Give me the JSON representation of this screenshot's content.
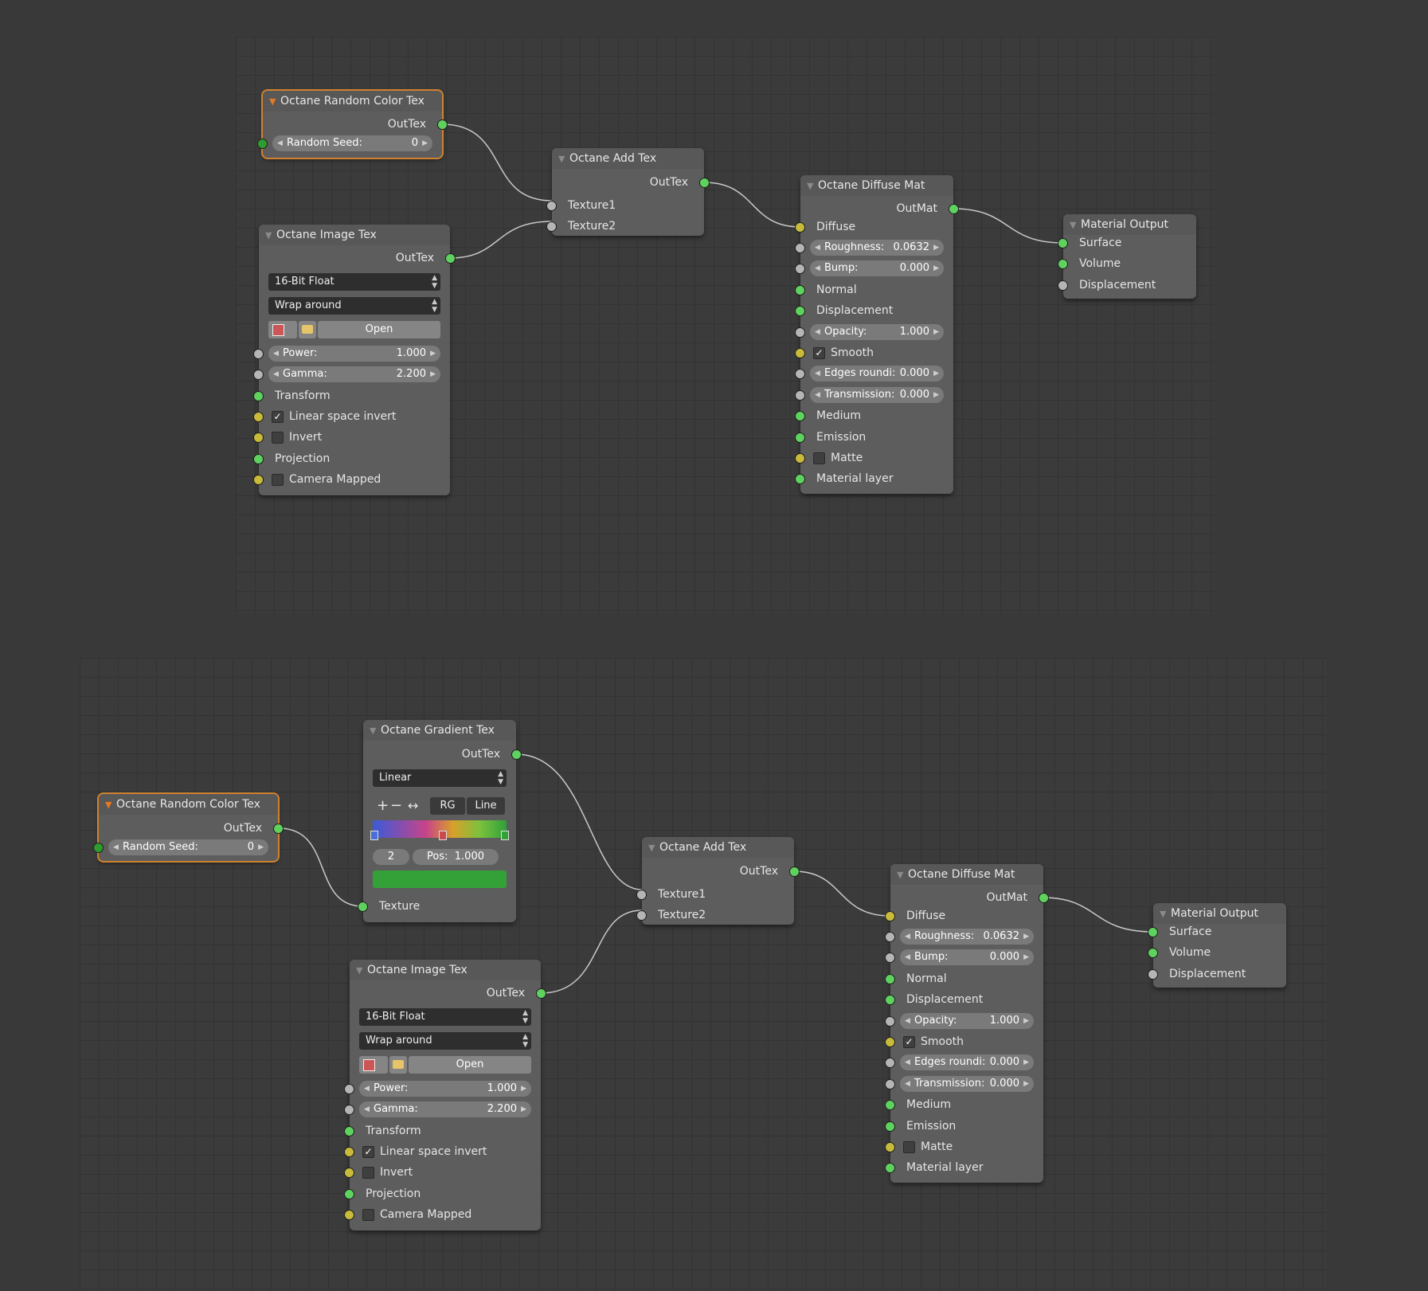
{
  "colors": {
    "accent_select": "#d0822e",
    "socket_green": "#5fd15f",
    "socket_yellow": "#c8bb3c",
    "socket_grey": "#b5b5b5",
    "ramp_stop": "#33a038"
  },
  "top": {
    "random": {
      "title": "Octane Random Color Tex",
      "out": "OutTex",
      "seed_label": "Random Seed:",
      "seed_value": "0"
    },
    "image": {
      "title": "Octane Image Tex",
      "out": "OutTex",
      "depth": "16-Bit Float",
      "wrap": "Wrap around",
      "open": "Open",
      "power_label": "Power:",
      "power_value": "1.000",
      "gamma_label": "Gamma:",
      "gamma_value": "2.200",
      "transform": "Transform",
      "linear": "Linear space invert",
      "invert": "Invert",
      "projection": "Projection",
      "camera": "Camera Mapped"
    },
    "add": {
      "title": "Octane Add Tex",
      "out": "OutTex",
      "t1": "Texture1",
      "t2": "Texture2"
    },
    "diffuse": {
      "title": "Octane Diffuse Mat",
      "out": "OutMat",
      "diffuse": "Diffuse",
      "rough_label": "Roughness:",
      "rough_value": "0.0632",
      "bump_label": "Bump:",
      "bump_value": "0.000",
      "normal": "Normal",
      "displacement": "Displacement",
      "opacity_label": "Opacity:",
      "opacity_value": "1.000",
      "smooth": "Smooth",
      "edges_label": "Edges roundi:",
      "edges_value": "0.000",
      "trans_label": "Transmission:",
      "trans_value": "0.000",
      "medium": "Medium",
      "emission": "Emission",
      "matte": "Matte",
      "layer": "Material layer"
    },
    "output": {
      "title": "Material Output",
      "surface": "Surface",
      "volume": "Volume",
      "displacement": "Displacement"
    }
  },
  "bottom": {
    "random": {
      "title": "Octane Random Color Tex",
      "out": "OutTex",
      "seed_label": "Random Seed:",
      "seed_value": "0"
    },
    "gradient": {
      "title": "Octane Gradient Tex",
      "out": "OutTex",
      "mode": "Linear",
      "color_mode": "RG",
      "interp": "Line",
      "index": "2",
      "pos_label": "Pos:",
      "pos_value": "1.000",
      "texture": "Texture"
    },
    "image": {
      "title": "Octane Image Tex",
      "out": "OutTex",
      "depth": "16-Bit Float",
      "wrap": "Wrap around",
      "open": "Open",
      "power_label": "Power:",
      "power_value": "1.000",
      "gamma_label": "Gamma:",
      "gamma_value": "2.200",
      "transform": "Transform",
      "linear": "Linear space invert",
      "invert": "Invert",
      "projection": "Projection",
      "camera": "Camera Mapped"
    },
    "add": {
      "title": "Octane Add Tex",
      "out": "OutTex",
      "t1": "Texture1",
      "t2": "Texture2"
    },
    "diffuse": {
      "title": "Octane Diffuse Mat",
      "out": "OutMat",
      "diffuse": "Diffuse",
      "rough_label": "Roughness:",
      "rough_value": "0.0632",
      "bump_label": "Bump:",
      "bump_value": "0.000",
      "normal": "Normal",
      "displacement": "Displacement",
      "opacity_label": "Opacity:",
      "opacity_value": "1.000",
      "smooth": "Smooth",
      "edges_label": "Edges roundi:",
      "edges_value": "0.000",
      "trans_label": "Transmission:",
      "trans_value": "0.000",
      "medium": "Medium",
      "emission": "Emission",
      "matte": "Matte",
      "layer": "Material layer"
    },
    "output": {
      "title": "Material Output",
      "surface": "Surface",
      "volume": "Volume",
      "displacement": "Displacement"
    }
  }
}
